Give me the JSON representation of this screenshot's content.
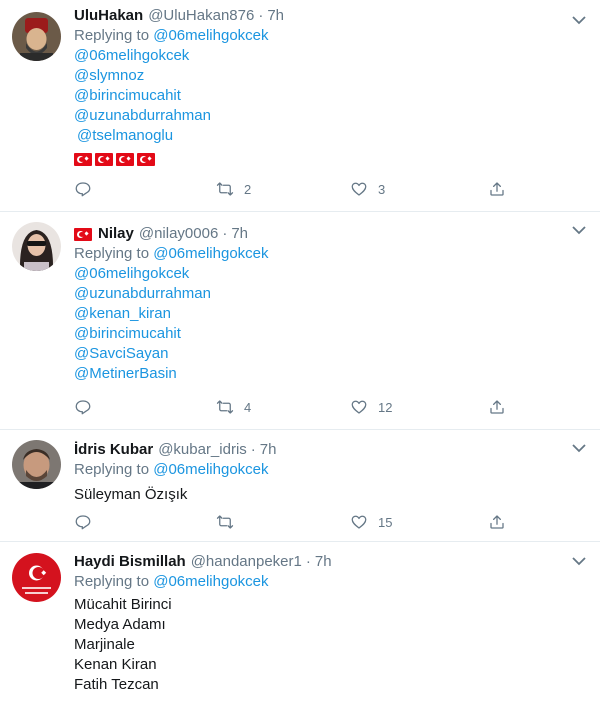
{
  "tweets": [
    {
      "name": "UluHakan",
      "handle": "@UluHakan876",
      "time": "7h",
      "replying_prefix": "Replying to ",
      "replying_to": "@06melihgokcek",
      "mentions": [
        "@06melihgokcek",
        "@slymnoz",
        "@birincimucahit",
        "@uzunabdurrahman",
        "@tselmanoglu"
      ],
      "flags_count": 4,
      "reply_count": "",
      "retweet_count": "2",
      "like_count": "3"
    },
    {
      "name": "Nilay",
      "handle": "@nilay0006",
      "time": "7h",
      "replying_prefix": "Replying to ",
      "replying_to": "@06melihgokcek",
      "mentions": [
        "@06melihgokcek",
        "@uzunabdurrahman",
        "@kenan_kiran",
        "@birincimucahit",
        "@SavciSayan",
        "@MetinerBasin"
      ],
      "reply_count": "",
      "retweet_count": "4",
      "like_count": "12"
    },
    {
      "name": "İdris Kubar",
      "handle": "@kubar_idris",
      "time": "7h",
      "replying_prefix": "Replying to ",
      "replying_to": "@06melihgokcek",
      "text_lines": [
        "Süleyman Özışık"
      ],
      "reply_count": "",
      "retweet_count": "",
      "like_count": "15"
    },
    {
      "name": "Haydi Bismillah",
      "handle": "@handanpeker1",
      "time": "7h",
      "replying_prefix": "Replying to ",
      "replying_to": "@06melihgokcek",
      "text_lines": [
        "Mücahit Birinci",
        "Medya Adamı",
        "Marjinale",
        "Kenan Kiran",
        "Fatih Tezcan"
      ]
    }
  ],
  "separator": "·",
  "colors": {
    "link": "#1b95e0",
    "muted": "#657786",
    "text": "#14171a",
    "border": "#e6ecf0",
    "turk_red": "#e30a17"
  },
  "icons": {
    "reply": "reply-icon",
    "retweet": "retweet-icon",
    "like": "heart-icon",
    "share": "share-icon",
    "more": "chevron-down-icon"
  }
}
